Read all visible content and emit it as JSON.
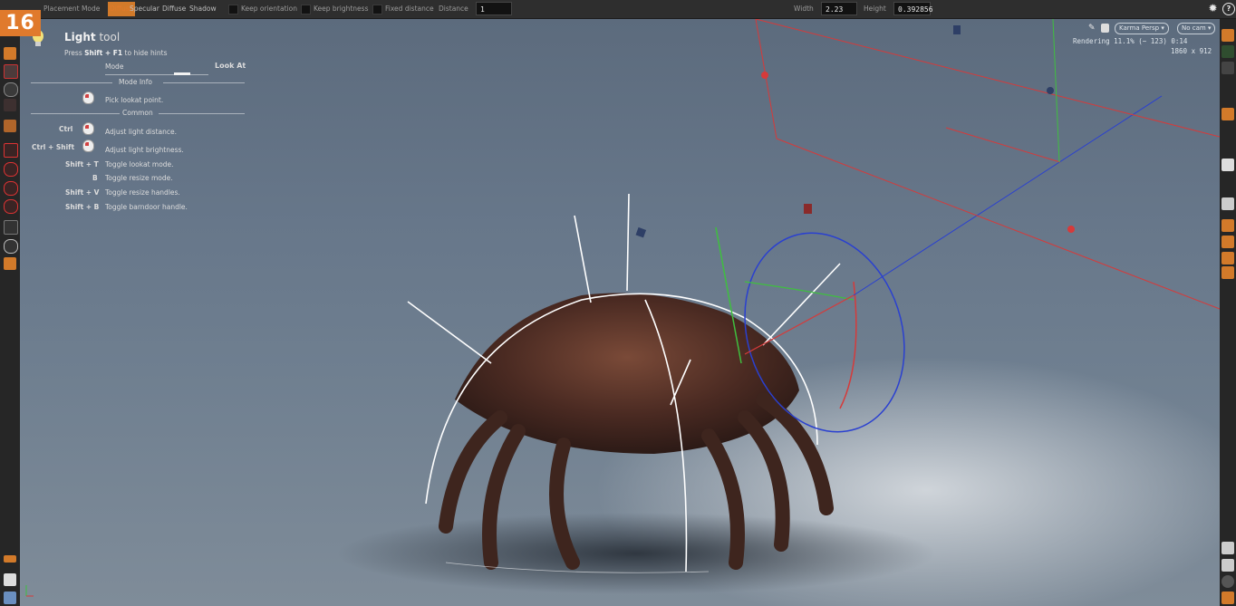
{
  "badge": "16",
  "toolbar": {
    "placement_mode_label": "Placement Mode",
    "modes": [
      "Diffuse",
      "Specular",
      "Diffuse",
      "Shadow"
    ],
    "keep_orientation": "Keep orientation",
    "keep_brightness": "Keep brightness",
    "fixed_distance": "Fixed distance",
    "distance_label": "Distance",
    "distance_value": "1",
    "width_label": "Width",
    "width_value": "2.23",
    "height_label": "Height",
    "height_value": "0.392856"
  },
  "hud": {
    "title_bold": "Light",
    "title_rest": " tool",
    "hint_pre": "Press ",
    "hint_key": "Shift + F1",
    "hint_post": " to hide hints",
    "mode_label": "Mode",
    "mode_value": "Look At",
    "mode_info_header": "Mode Info",
    "pick_text": "Pick lookat point.",
    "common_header": "Common",
    "shortcuts": [
      {
        "keys": "Ctrl",
        "action": "Adjust light distance."
      },
      {
        "keys": "Ctrl + Shift",
        "action": "Adjust light brightness."
      },
      {
        "keys": "Shift + T",
        "action": "Toggle lookat mode."
      },
      {
        "keys": "B",
        "action": "Toggle resize mode."
      },
      {
        "keys": "Shift + V",
        "action": "Toggle resize handles."
      },
      {
        "keys": "Shift + B",
        "action": "Toggle barndoor handle."
      }
    ]
  },
  "viewport_header": {
    "renderer": "Karma Persp",
    "camera": "No cam",
    "rendering_line": "Rendering  11.1%  (~ 123)  0:14",
    "resolution_line": "1860 x 912"
  },
  "icons": {
    "light-bulb-icon": "light-bulb",
    "mouse-icon": "mouse",
    "pin-icon": "pin",
    "lock-icon": "lock",
    "gear-icon": "gear",
    "help-icon": "help"
  },
  "colors": {
    "accent": "#e07a2c",
    "toolbar_bg": "#2e2e2e",
    "viewport_top": "#5c6b7d",
    "handle_red": "#d63a3a",
    "handle_green": "#3fbf3f",
    "handle_blue": "#2a40d0"
  }
}
